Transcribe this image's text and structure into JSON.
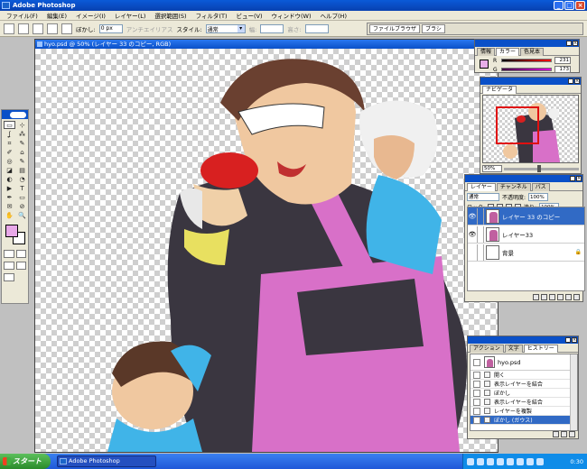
{
  "window": {
    "title": "Adobe Photoshop",
    "buttons": [
      "_",
      "□",
      "×"
    ]
  },
  "menu": [
    "ファイル(F)",
    "編集(E)",
    "イメージ(I)",
    "レイヤー(L)",
    "選択範囲(S)",
    "フィルタ(T)",
    "ビュー(V)",
    "ウィンドウ(W)",
    "ヘルプ(H)"
  ],
  "options": {
    "feather_label": "ぼかし:",
    "feather_value": "0 px",
    "antialias_label": "アンチエイリアス",
    "style_label": "スタイル:",
    "style_value": "通常",
    "width_label": "幅:",
    "height_label": "高さ:",
    "well_tabs": [
      "ファイルブラウザ",
      "ブラシ"
    ]
  },
  "document": {
    "title": "hyo.psd @ 50% (レイヤー 33 のコピー, RGB)"
  },
  "toolbox": {
    "tools": [
      "▭",
      "⊹",
      "ʆ",
      "⁂",
      "⌗",
      "✎",
      "✐",
      "⌂",
      "◎",
      "✎",
      "◪",
      "▤",
      "◐",
      "◔",
      "▶",
      "T",
      "✒",
      "▭",
      "✉",
      "⊘",
      "✋",
      "🔍"
    ],
    "fg_color": "#e8a8e8"
  },
  "color_panel": {
    "tabs": [
      "情報",
      "カラー",
      "色見本"
    ],
    "channels": [
      {
        "label": "R",
        "value": "231"
      },
      {
        "label": "G",
        "value": "173"
      }
    ],
    "chip_color": "#e8ade8"
  },
  "navigator_panel": {
    "tabs": [
      "ナビゲータ"
    ],
    "zoom": "50%"
  },
  "layers_panel": {
    "tabs": [
      "レイヤー",
      "チャンネル",
      "パス"
    ],
    "blend_mode": "通常",
    "opacity_label": "不透明度:",
    "opacity": "100%",
    "lock_label": "ロック:",
    "fill_label": "塗り:",
    "fill": "100%",
    "layers": [
      {
        "name": "レイヤー 33 のコピー",
        "selected": true
      },
      {
        "name": "レイヤー33",
        "selected": false
      },
      {
        "name": "背景",
        "selected": false
      }
    ]
  },
  "history_panel": {
    "tabs": [
      "アクション",
      "文字",
      "ヒストリー"
    ],
    "snapshot": "hyo.psd",
    "steps": [
      "開く",
      "表示レイヤーを結合",
      "ぼかし",
      "表示レイヤーを結合",
      "レイヤーを複製",
      "ぼかし (ガウス)"
    ],
    "selected_step": 5
  },
  "taskbar": {
    "start": "スタート",
    "task": "Adobe Photoshop",
    "time": "0:30"
  },
  "colors": {
    "accent_blue": "#316ac5",
    "title_blue": "#0a50c8",
    "apron_pink": "#d870c8"
  }
}
